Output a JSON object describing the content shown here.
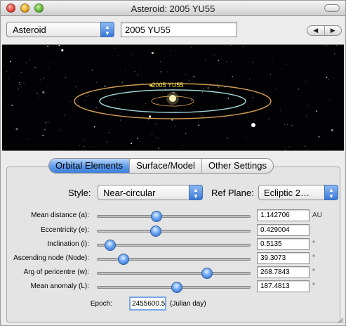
{
  "window": {
    "title": "Asteroid: 2005 YU55"
  },
  "top": {
    "object_type": "Asteroid",
    "object_name": "2005 YU55",
    "nav_prev": "◀",
    "nav_next": "▶"
  },
  "space_view": {
    "object_label": "◂2005 YU55",
    "colors": {
      "background": "#020204",
      "orbit": "#d09a55",
      "earth_orbit": "#9fd0d6",
      "label": "#f3e23a",
      "sun": "#fff6c9"
    }
  },
  "tabs": [
    {
      "label": "Orbital Elements",
      "active": true
    },
    {
      "label": "Surface/Model",
      "active": false
    },
    {
      "label": "Other Settings",
      "active": false
    }
  ],
  "style": {
    "label": "Style:",
    "value": "Near-circular"
  },
  "ref_plane": {
    "label": "Ref Plane:",
    "value": "Ecliptic 2…"
  },
  "elements": [
    {
      "label": "Mean distance (a):",
      "value": "1.142706",
      "unit": "AU",
      "slider_fraction": 0.38
    },
    {
      "label": "Eccentricity (e):",
      "value": "0.429004",
      "unit": "",
      "slider_fraction": 0.375
    },
    {
      "label": "Inclination (i):",
      "value": "0.5135",
      "unit": "°",
      "slider_fraction": 0.055
    },
    {
      "label": "Ascending node (Node):",
      "value": "39.3073",
      "unit": "°",
      "slider_fraction": 0.15
    },
    {
      "label": "Arg of pericentre (w):",
      "value": "268.7843",
      "unit": "°",
      "slider_fraction": 0.735
    },
    {
      "label": "Mean anomaly (L):",
      "value": "187.4813",
      "unit": "°",
      "slider_fraction": 0.52
    }
  ],
  "epoch": {
    "label": "Epoch:",
    "value": "2455600.5",
    "unit": "(Julian day)"
  }
}
